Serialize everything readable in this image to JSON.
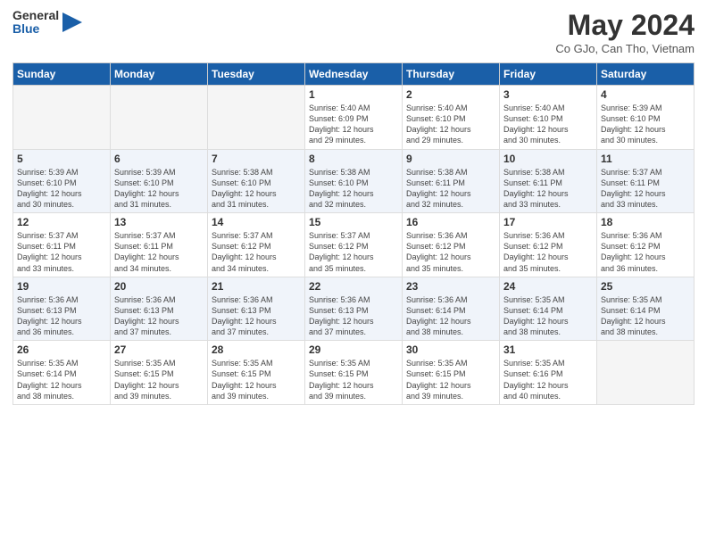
{
  "header": {
    "logo_line1": "General",
    "logo_line2": "Blue",
    "month": "May 2024",
    "location": "Co GJo, Can Tho, Vietnam"
  },
  "days_of_week": [
    "Sunday",
    "Monday",
    "Tuesday",
    "Wednesday",
    "Thursday",
    "Friday",
    "Saturday"
  ],
  "weeks": [
    [
      {
        "day": "",
        "info": ""
      },
      {
        "day": "",
        "info": ""
      },
      {
        "day": "",
        "info": ""
      },
      {
        "day": "1",
        "info": "Sunrise: 5:40 AM\nSunset: 6:09 PM\nDaylight: 12 hours\nand 29 minutes."
      },
      {
        "day": "2",
        "info": "Sunrise: 5:40 AM\nSunset: 6:10 PM\nDaylight: 12 hours\nand 29 minutes."
      },
      {
        "day": "3",
        "info": "Sunrise: 5:40 AM\nSunset: 6:10 PM\nDaylight: 12 hours\nand 30 minutes."
      },
      {
        "day": "4",
        "info": "Sunrise: 5:39 AM\nSunset: 6:10 PM\nDaylight: 12 hours\nand 30 minutes."
      }
    ],
    [
      {
        "day": "5",
        "info": "Sunrise: 5:39 AM\nSunset: 6:10 PM\nDaylight: 12 hours\nand 30 minutes."
      },
      {
        "day": "6",
        "info": "Sunrise: 5:39 AM\nSunset: 6:10 PM\nDaylight: 12 hours\nand 31 minutes."
      },
      {
        "day": "7",
        "info": "Sunrise: 5:38 AM\nSunset: 6:10 PM\nDaylight: 12 hours\nand 31 minutes."
      },
      {
        "day": "8",
        "info": "Sunrise: 5:38 AM\nSunset: 6:10 PM\nDaylight: 12 hours\nand 32 minutes."
      },
      {
        "day": "9",
        "info": "Sunrise: 5:38 AM\nSunset: 6:11 PM\nDaylight: 12 hours\nand 32 minutes."
      },
      {
        "day": "10",
        "info": "Sunrise: 5:38 AM\nSunset: 6:11 PM\nDaylight: 12 hours\nand 33 minutes."
      },
      {
        "day": "11",
        "info": "Sunrise: 5:37 AM\nSunset: 6:11 PM\nDaylight: 12 hours\nand 33 minutes."
      }
    ],
    [
      {
        "day": "12",
        "info": "Sunrise: 5:37 AM\nSunset: 6:11 PM\nDaylight: 12 hours\nand 33 minutes."
      },
      {
        "day": "13",
        "info": "Sunrise: 5:37 AM\nSunset: 6:11 PM\nDaylight: 12 hours\nand 34 minutes."
      },
      {
        "day": "14",
        "info": "Sunrise: 5:37 AM\nSunset: 6:12 PM\nDaylight: 12 hours\nand 34 minutes."
      },
      {
        "day": "15",
        "info": "Sunrise: 5:37 AM\nSunset: 6:12 PM\nDaylight: 12 hours\nand 35 minutes."
      },
      {
        "day": "16",
        "info": "Sunrise: 5:36 AM\nSunset: 6:12 PM\nDaylight: 12 hours\nand 35 minutes."
      },
      {
        "day": "17",
        "info": "Sunrise: 5:36 AM\nSunset: 6:12 PM\nDaylight: 12 hours\nand 35 minutes."
      },
      {
        "day": "18",
        "info": "Sunrise: 5:36 AM\nSunset: 6:12 PM\nDaylight: 12 hours\nand 36 minutes."
      }
    ],
    [
      {
        "day": "19",
        "info": "Sunrise: 5:36 AM\nSunset: 6:13 PM\nDaylight: 12 hours\nand 36 minutes."
      },
      {
        "day": "20",
        "info": "Sunrise: 5:36 AM\nSunset: 6:13 PM\nDaylight: 12 hours\nand 37 minutes."
      },
      {
        "day": "21",
        "info": "Sunrise: 5:36 AM\nSunset: 6:13 PM\nDaylight: 12 hours\nand 37 minutes."
      },
      {
        "day": "22",
        "info": "Sunrise: 5:36 AM\nSunset: 6:13 PM\nDaylight: 12 hours\nand 37 minutes."
      },
      {
        "day": "23",
        "info": "Sunrise: 5:36 AM\nSunset: 6:14 PM\nDaylight: 12 hours\nand 38 minutes."
      },
      {
        "day": "24",
        "info": "Sunrise: 5:35 AM\nSunset: 6:14 PM\nDaylight: 12 hours\nand 38 minutes."
      },
      {
        "day": "25",
        "info": "Sunrise: 5:35 AM\nSunset: 6:14 PM\nDaylight: 12 hours\nand 38 minutes."
      }
    ],
    [
      {
        "day": "26",
        "info": "Sunrise: 5:35 AM\nSunset: 6:14 PM\nDaylight: 12 hours\nand 38 minutes."
      },
      {
        "day": "27",
        "info": "Sunrise: 5:35 AM\nSunset: 6:15 PM\nDaylight: 12 hours\nand 39 minutes."
      },
      {
        "day": "28",
        "info": "Sunrise: 5:35 AM\nSunset: 6:15 PM\nDaylight: 12 hours\nand 39 minutes."
      },
      {
        "day": "29",
        "info": "Sunrise: 5:35 AM\nSunset: 6:15 PM\nDaylight: 12 hours\nand 39 minutes."
      },
      {
        "day": "30",
        "info": "Sunrise: 5:35 AM\nSunset: 6:15 PM\nDaylight: 12 hours\nand 39 minutes."
      },
      {
        "day": "31",
        "info": "Sunrise: 5:35 AM\nSunset: 6:16 PM\nDaylight: 12 hours\nand 40 minutes."
      },
      {
        "day": "",
        "info": ""
      }
    ]
  ]
}
